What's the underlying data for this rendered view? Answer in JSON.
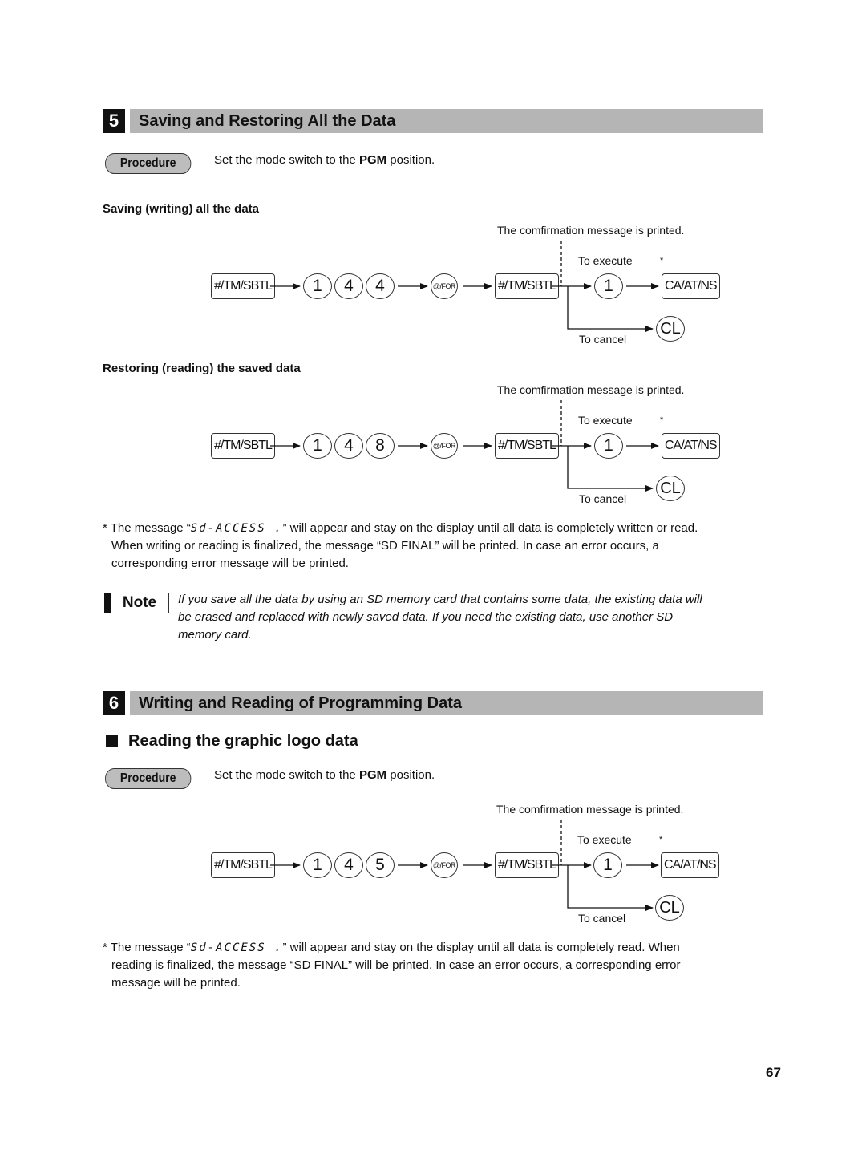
{
  "section5": {
    "number": "5",
    "title": "Saving and Restoring All the Data",
    "procedure_label": "Procedure",
    "procedure_text_pre": "Set the mode switch to the ",
    "procedure_text_bold": "PGM",
    "procedure_text_post": " position.",
    "saving": {
      "heading": "Saving (writing) all the data",
      "confirmation": "The comfirmation message is printed.",
      "to_execute": "To execute",
      "to_cancel": "To cancel",
      "asterisk": "*",
      "keys": [
        "#/TM/SBTL",
        "1",
        "4",
        "4",
        "@/FOR",
        "#/TM/SBTL",
        "1",
        "CA/AT/NS",
        "CL"
      ]
    },
    "restoring": {
      "heading": "Restoring (reading) the saved data",
      "confirmation": "The comfirmation message is printed.",
      "to_execute": "To execute",
      "to_cancel": "To cancel",
      "asterisk": "*",
      "keys": [
        "#/TM/SBTL",
        "1",
        "4",
        "8",
        "@/FOR",
        "#/TM/SBTL",
        "1",
        "CA/AT/NS",
        "CL"
      ]
    },
    "footnote": {
      "star": "*",
      "pre": "The message “",
      "lcd": "Sd-ACCESS .",
      "line1_post": "” will appear and stay on the display until all data is completely written or read.",
      "line2": "When writing or reading is finalized, the message “SD FINAL” will be printed. In case an error occurs, a",
      "line3": "corresponding error message will be printed."
    },
    "note": {
      "label": "Note",
      "line1": "If you save all the data by using an SD memory card that contains some data, the existing data will",
      "line2": "be erased and replaced with newly saved data. If you need the existing data, use another SD",
      "line3": "memory card."
    }
  },
  "section6": {
    "number": "6",
    "title": "Writing and Reading of Programming Data",
    "subsection": "Reading the graphic logo data",
    "procedure_label": "Procedure",
    "procedure_text_pre": "Set the mode switch to the ",
    "procedure_text_bold": "PGM",
    "procedure_text_post": " position.",
    "flow": {
      "confirmation": "The comfirmation message is printed.",
      "to_execute": "To execute",
      "to_cancel": "To cancel",
      "asterisk": "*",
      "keys": [
        "#/TM/SBTL",
        "1",
        "4",
        "5",
        "@/FOR",
        "#/TM/SBTL",
        "1",
        "CA/AT/NS",
        "CL"
      ]
    },
    "footnote": {
      "star": "*",
      "pre": "The message “",
      "lcd": "Sd-ACCESS .",
      "line1_post": "” will appear and stay on the display until all data is completely read. When",
      "line2": "reading is finalized, the message “SD FINAL” will be printed. In case an error occurs, a corresponding error",
      "line3": "message will be printed."
    }
  },
  "page_number": "67"
}
